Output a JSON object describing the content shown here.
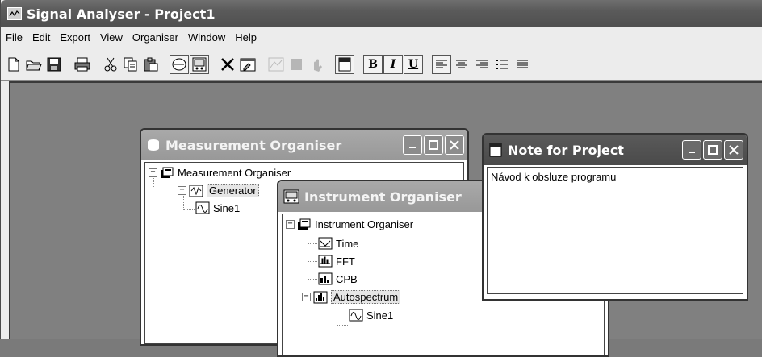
{
  "app": {
    "title": "Signal Analyser - Project1"
  },
  "menu": [
    "File",
    "Edit",
    "Export",
    "View",
    "Organiser",
    "Window",
    "Help"
  ],
  "toolbar": {
    "bold": "B",
    "italic": "I",
    "underline": "U"
  },
  "measurement_organiser": {
    "title": "Measurement Organiser",
    "root_label": "Measurement Organiser",
    "child_label": "Generator",
    "leaf_label": "Sine1"
  },
  "instrument_organiser": {
    "title": "Instrument Organiser",
    "root_label": "Instrument Organiser",
    "items": [
      "Time",
      "FFT",
      "CPB",
      "Autospectrum"
    ],
    "leaf_label": "Sine1"
  },
  "note": {
    "title": "Note for Project",
    "text": "Návod k obsluze programu"
  }
}
